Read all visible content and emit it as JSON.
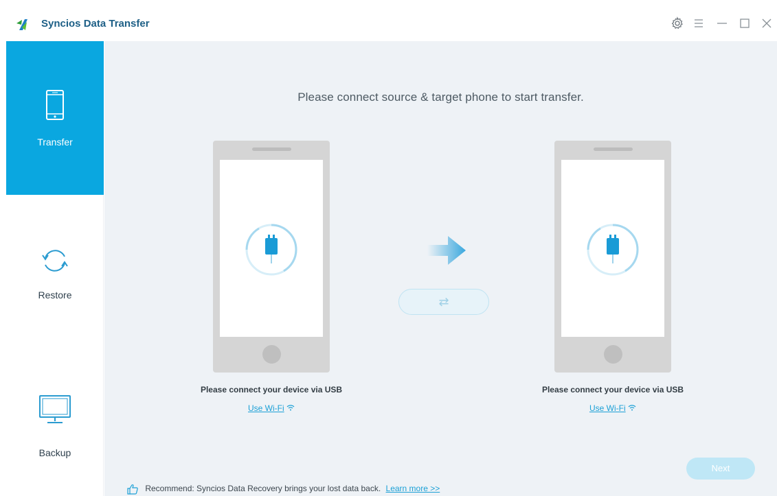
{
  "app": {
    "title": "Syncios Data Transfer"
  },
  "titlebar": {
    "icons": [
      "settings-gear-icon",
      "menu-icon",
      "minimize-icon",
      "maximize-icon",
      "close-icon"
    ]
  },
  "sidebar": {
    "items": [
      {
        "label": "Transfer",
        "icon": "phone-icon",
        "active": true
      },
      {
        "label": "Restore",
        "icon": "sync-circle-icon",
        "active": false
      },
      {
        "label": "Backup",
        "icon": "monitor-icon",
        "active": false
      }
    ]
  },
  "main": {
    "headline": "Please connect source & target phone to start transfer.",
    "source": {
      "connect_text": "Please connect your device via USB",
      "wifi_label": "Use Wi-Fi"
    },
    "target": {
      "connect_text": "Please connect your device via USB",
      "wifi_label": "Use Wi-Fi"
    },
    "swap_glyph": "⇄",
    "next_label": "Next",
    "recommend": {
      "text": "Recommend: Syncios Data Recovery brings your lost data back.",
      "link": "Learn more >>"
    }
  },
  "colors": {
    "accent": "#0aa7e0",
    "link": "#1ba0d6",
    "title": "#1d5f86",
    "main_bg": "#eef2f6"
  }
}
